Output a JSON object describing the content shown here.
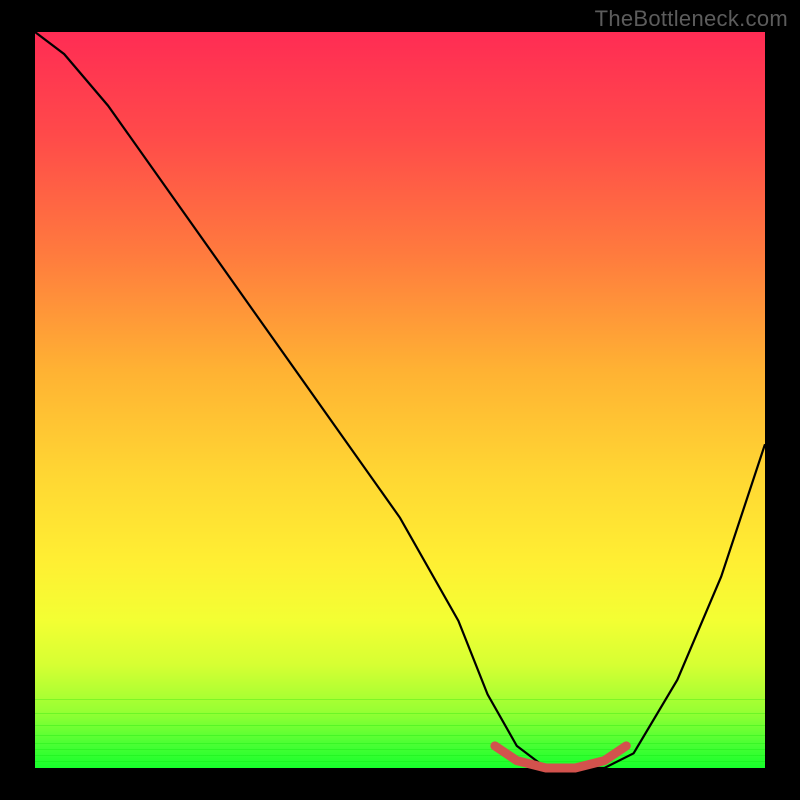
{
  "watermark": "TheBottleneck.com",
  "chart_data": {
    "type": "line",
    "title": "",
    "xlabel": "",
    "ylabel": "",
    "xlim": [
      0,
      100
    ],
    "ylim": [
      0,
      100
    ],
    "series": [
      {
        "name": "bottleneck-curve",
        "x": [
          0,
          4,
          10,
          20,
          30,
          40,
          50,
          58,
          62,
          66,
          70,
          74,
          78,
          82,
          88,
          94,
          100
        ],
        "y": [
          100,
          97,
          90,
          76,
          62,
          48,
          34,
          20,
          10,
          3,
          0,
          0,
          0,
          2,
          12,
          26,
          44
        ]
      },
      {
        "name": "highlight-trough",
        "x": [
          63,
          66,
          70,
          74,
          78,
          81
        ],
        "y": [
          3,
          1,
          0,
          0,
          1,
          3
        ]
      }
    ],
    "colors": {
      "curve": "#000000",
      "highlight": "#d2524d",
      "gradient_top": "#ff2c54",
      "gradient_bottom": "#17ff2b"
    }
  }
}
